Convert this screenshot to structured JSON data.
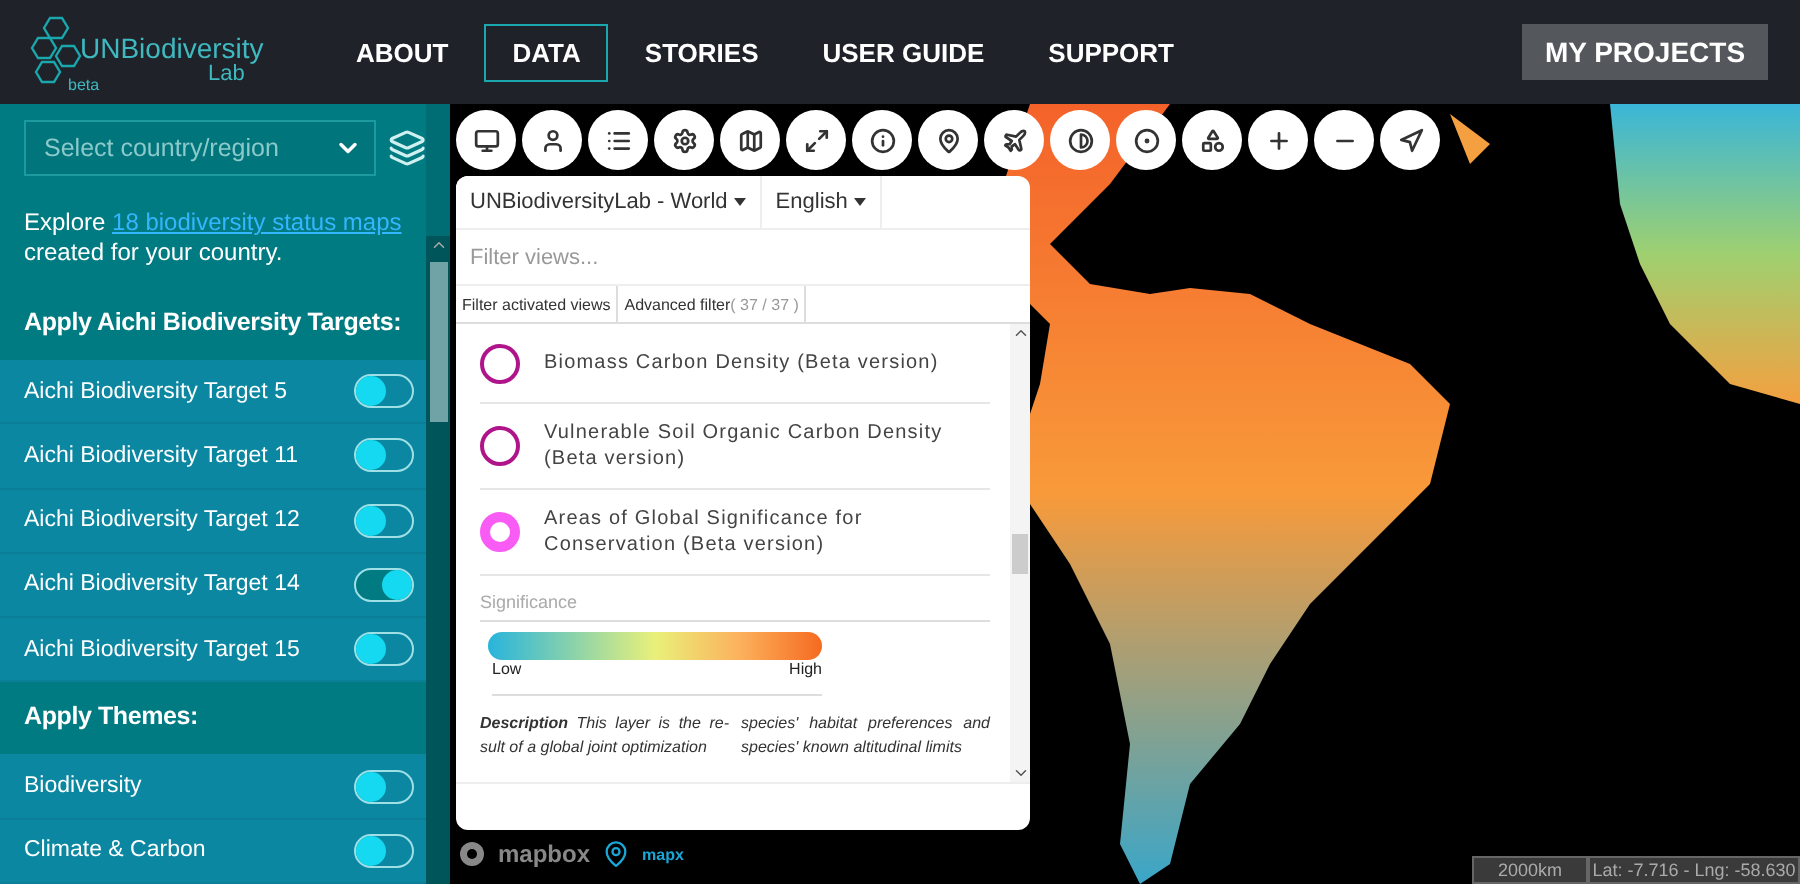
{
  "header": {
    "logo": {
      "name": "UNBiodiversity",
      "sub": "Lab",
      "badge": "beta"
    },
    "nav": [
      {
        "label": "ABOUT",
        "selected": false
      },
      {
        "label": "DATA",
        "selected": true
      },
      {
        "label": "STORIES",
        "selected": false
      },
      {
        "label": "USER GUIDE",
        "selected": false
      },
      {
        "label": "SUPPORT",
        "selected": false
      }
    ],
    "account_button": "MY PROJECTS"
  },
  "sidebar": {
    "country_select": {
      "placeholder": "Select country/region"
    },
    "intro": {
      "before": "Explore ",
      "link": "18 biodiversity status maps",
      "after": " created for your country."
    },
    "sections": [
      {
        "title": "Apply Aichi Biodiversity Targets:",
        "items": [
          {
            "label": "Aichi Biodiversity Target 5",
            "on": false
          },
          {
            "label": "Aichi Biodiversity Target 11",
            "on": false
          },
          {
            "label": "Aichi Biodiversity Target 12",
            "on": false
          },
          {
            "label": "Aichi Biodiversity Target 14",
            "on": true
          },
          {
            "label": "Aichi Biodiversity Target 15",
            "on": false
          }
        ]
      },
      {
        "title": "Apply Themes:",
        "items": [
          {
            "label": "Biodiversity",
            "on": false
          },
          {
            "label": "Climate & Carbon",
            "on": false
          }
        ]
      }
    ]
  },
  "views_panel": {
    "project_select": "UNBiodiversityLab - World",
    "language_select": "English",
    "filter": {
      "placeholder": "Filter views..."
    },
    "tabs": [
      {
        "label": "Filter activated views"
      },
      {
        "label": "Advanced filter",
        "count": "( 37 / 37 )"
      }
    ],
    "views": [
      {
        "title": "Biomass Carbon Density (Beta version)",
        "active": false
      },
      {
        "title": "Vulnerable Soil Organic Carbon Density (Beta version)",
        "active": false
      },
      {
        "title": "Areas of Global Significance for Conservation (Beta version)",
        "active": true,
        "legend": {
          "title": "Significance",
          "low": "Low",
          "high": "High"
        },
        "description": [
          "**Description** This layer is the re-sult of a global joint optimization",
          "species' habitat preferences and species' known altitudinal limits"
        ]
      }
    ]
  },
  "map_footer": {
    "attribution": "mapbox",
    "brand": "mapx",
    "scale": "2000km",
    "coordinates": "Lat: -7.716 - Lng: -58.630"
  }
}
